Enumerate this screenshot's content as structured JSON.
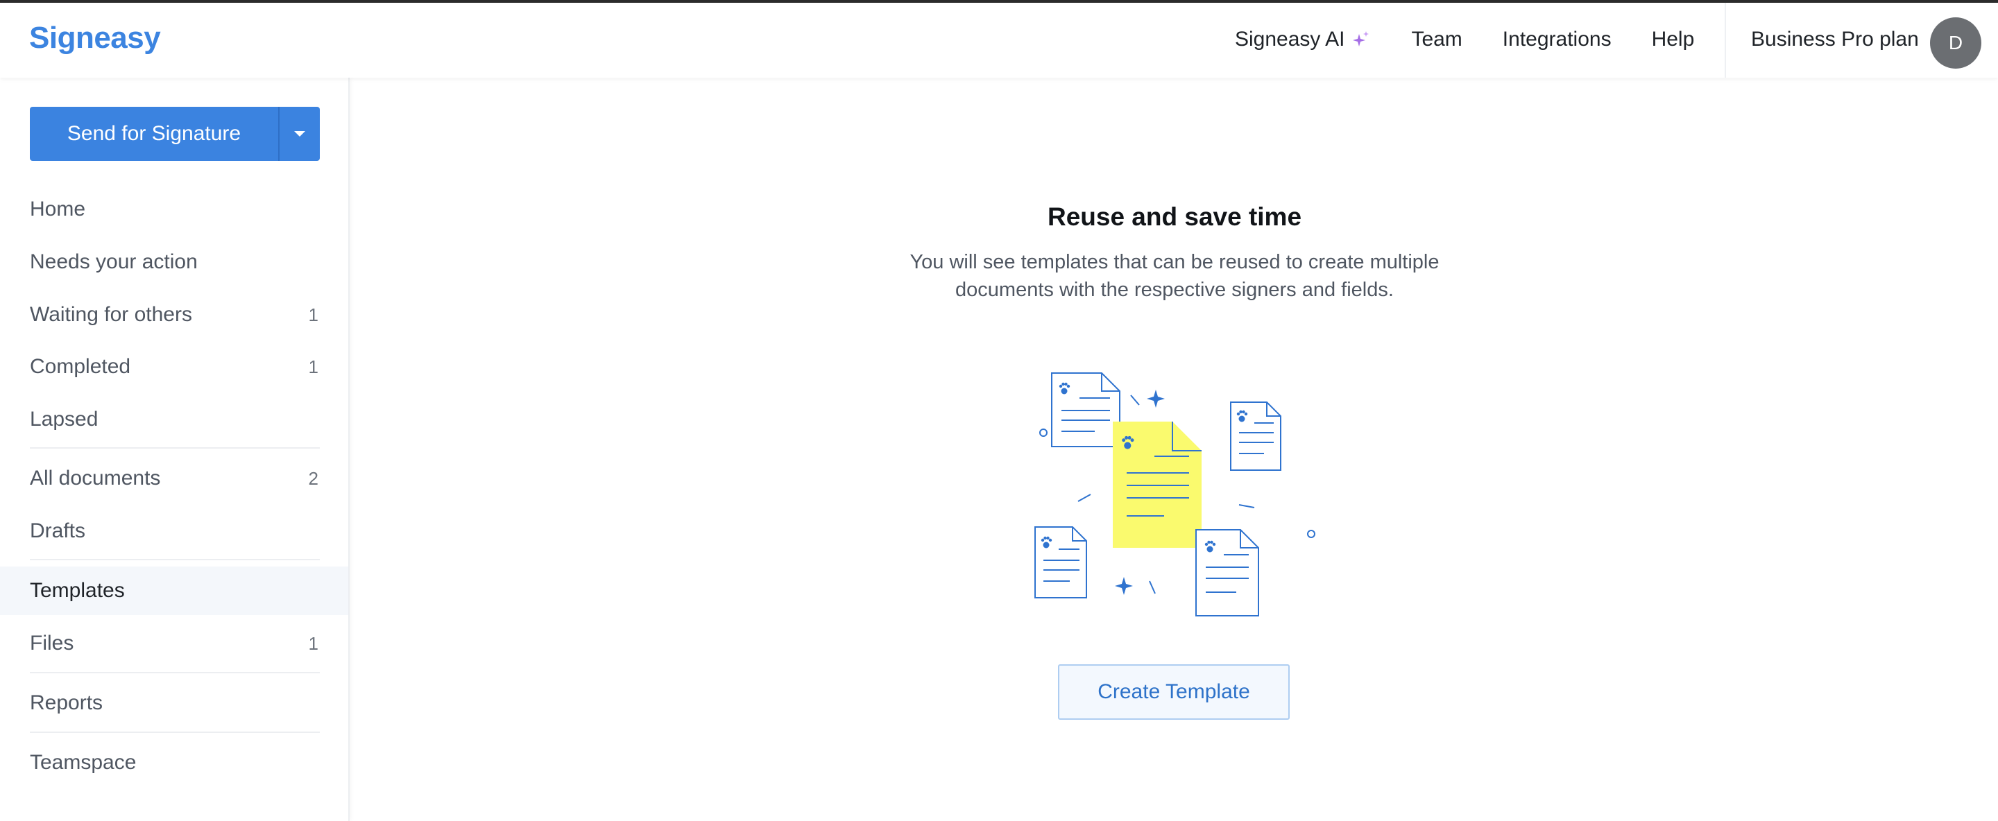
{
  "header": {
    "logo": "Signeasy",
    "nav": {
      "signeasy_ai": "Signeasy AI",
      "team": "Team",
      "integrations": "Integrations",
      "help": "Help"
    },
    "plan": "Business Pro plan",
    "avatar_initial": "D"
  },
  "sidebar": {
    "send_button": "Send for Signature",
    "items": [
      {
        "label": "Home",
        "count": ""
      },
      {
        "label": "Needs your action",
        "count": ""
      },
      {
        "label": "Waiting for others",
        "count": "1"
      },
      {
        "label": "Completed",
        "count": "1"
      },
      {
        "label": "Lapsed",
        "count": ""
      },
      {
        "label": "All documents",
        "count": "2"
      },
      {
        "label": "Drafts",
        "count": ""
      },
      {
        "label": "Templates",
        "count": ""
      },
      {
        "label": "Files",
        "count": "1"
      },
      {
        "label": "Reports",
        "count": ""
      },
      {
        "label": "Teamspace",
        "count": ""
      }
    ]
  },
  "main": {
    "title": "Reuse and save time",
    "description": "You will see templates that can be reused to create multiple documents with the respective signers and fields.",
    "create_button": "Create Template"
  },
  "colors": {
    "brand": "#3c84e0",
    "primary_button": "#3b83e0",
    "highlight_doc": "#fafa6e",
    "avatar_bg": "#6b6e72"
  }
}
